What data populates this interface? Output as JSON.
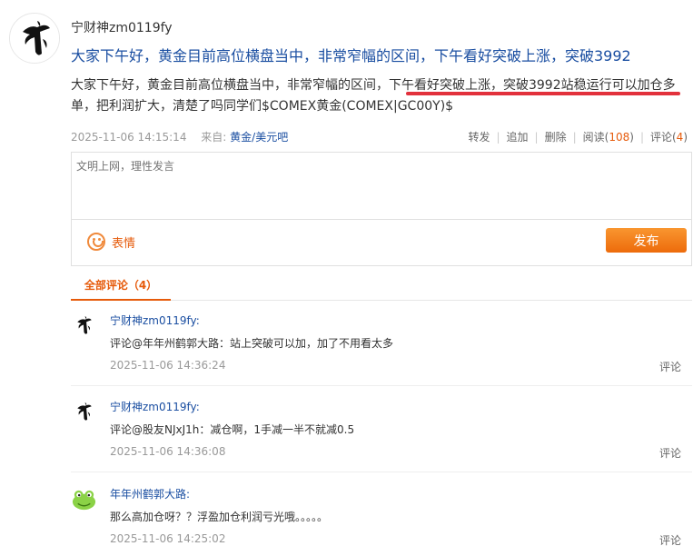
{
  "post": {
    "author": "宁财神zm0119fy",
    "title": "大家下午好，黄金目前高位横盘当中，非常窄幅的区间，下午看好突破上涨，突破3992",
    "body_part1": "大家下午好，黄金目前高位横盘当中，非常窄幅的区间，下午看好突破上涨，突破3992站稳运行可以加仓多",
    "body_part2": "单，把利润扩大，清楚了吗同学们$COMEX黄金(COMEX|GC00Y)$",
    "time": "2025-11-06 14:15:14",
    "source_label": "来自:",
    "source_link": "黄金/美元吧",
    "actions": {
      "repost": "转发",
      "add": "追加",
      "delete": "删除",
      "read_label": "阅读(",
      "read_count": "108",
      "comment_label": "评论(",
      "comment_count": "4",
      "close_paren": ")"
    }
  },
  "editor": {
    "placeholder": "文明上网，理性发言",
    "emoji_label": "表情",
    "publish_label": "发布"
  },
  "tabs": {
    "all_comments": "全部评论（4）"
  },
  "comments": [
    {
      "user": "宁财神zm0119fy:",
      "text": "评论@年年州鹤郭大路：站上突破可以加，加了不用看太多",
      "time": "2025-11-06 14:36:24",
      "reply": "评论"
    },
    {
      "user": "宁财神zm0119fy:",
      "text": "评论@股友NJxJ1h：减仓啊，1手减一半不就减0.5",
      "time": "2025-11-06 14:36:08",
      "reply": "评论"
    },
    {
      "user": "年年州鹤郭大路:",
      "text": "那么高加仓呀？？浮盈加仓利润亏光哦。。。。。",
      "time": "2025-11-06 14:25:02",
      "reply": "评论"
    }
  ],
  "colors": {
    "link_blue": "#1a4ea1",
    "accent_orange": "#e65a0a",
    "highlight_red": "#e2313c"
  }
}
